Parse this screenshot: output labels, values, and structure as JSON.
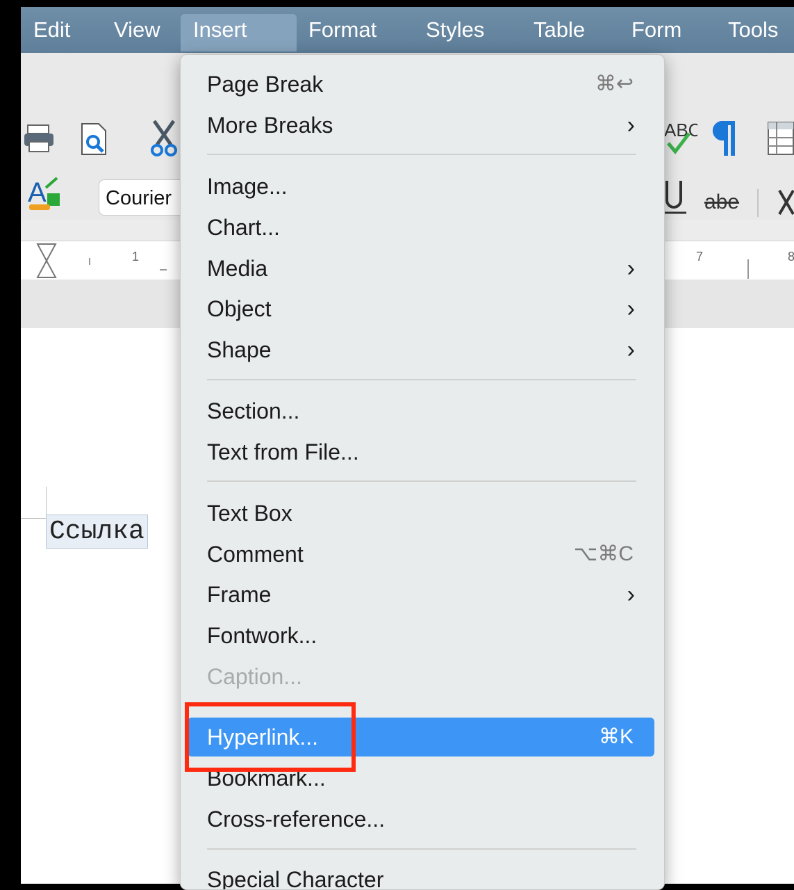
{
  "menubar": {
    "items": [
      {
        "label": "Edit"
      },
      {
        "label": "View"
      },
      {
        "label": "Insert"
      },
      {
        "label": "Format"
      },
      {
        "label": "Styles"
      },
      {
        "label": "Table"
      },
      {
        "label": "Form"
      },
      {
        "label": "Tools"
      }
    ],
    "active": "Insert"
  },
  "toolbar": {
    "font_name": "Courier",
    "strikethrough_label": "abe",
    "spelling_label": "ABC"
  },
  "ruler": {
    "ticks": [
      "1",
      "7",
      "8"
    ]
  },
  "document": {
    "text": "Ссылка"
  },
  "insert_menu": {
    "items": [
      {
        "label": "Page Break",
        "accel": "⌘↩"
      },
      {
        "label": "More Breaks",
        "submenu": true
      },
      {
        "label": "Image..."
      },
      {
        "label": "Chart..."
      },
      {
        "label": "Media",
        "submenu": true
      },
      {
        "label": "Object",
        "submenu": true
      },
      {
        "label": "Shape",
        "submenu": true
      },
      {
        "label": "Section..."
      },
      {
        "label": "Text from File..."
      },
      {
        "label": "Text Box"
      },
      {
        "label": "Comment",
        "accel": "⌥⌘C"
      },
      {
        "label": "Frame",
        "submenu": true
      },
      {
        "label": "Fontwork..."
      },
      {
        "label": "Caption...",
        "disabled": true
      },
      {
        "label": "Hyperlink...",
        "accel": "⌘K",
        "highlighted": true
      },
      {
        "label": "Bookmark..."
      },
      {
        "label": "Cross-reference..."
      },
      {
        "label": "Special Character"
      }
    ]
  },
  "colors": {
    "menubar": "#6f8ea8",
    "highlight": "#3d96f5",
    "annotation": "#ff2a10"
  }
}
